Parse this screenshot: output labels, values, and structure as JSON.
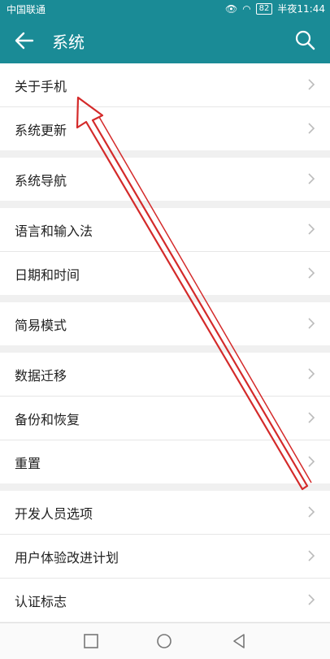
{
  "status": {
    "carrier": "中国联通",
    "battery": "82",
    "time": "半夜11:44"
  },
  "header": {
    "title": "系统"
  },
  "groups": [
    {
      "items": [
        {
          "label": "关于手机"
        },
        {
          "label": "系统更新"
        }
      ]
    },
    {
      "items": [
        {
          "label": "系统导航"
        }
      ]
    },
    {
      "items": [
        {
          "label": "语言和输入法"
        },
        {
          "label": "日期和时间"
        }
      ]
    },
    {
      "items": [
        {
          "label": "简易模式"
        }
      ]
    },
    {
      "items": [
        {
          "label": "数据迁移"
        },
        {
          "label": "备份和恢复"
        },
        {
          "label": "重置"
        }
      ]
    },
    {
      "items": [
        {
          "label": "开发人员选项"
        },
        {
          "label": "用户体验改进计划"
        },
        {
          "label": "认证标志"
        }
      ]
    }
  ],
  "icons": {
    "back": "arrow-left-icon",
    "search": "search-icon",
    "chevron": "chevron-right-icon"
  },
  "colors": {
    "header": "#1a8b96",
    "annotation": "#d42a2a"
  }
}
